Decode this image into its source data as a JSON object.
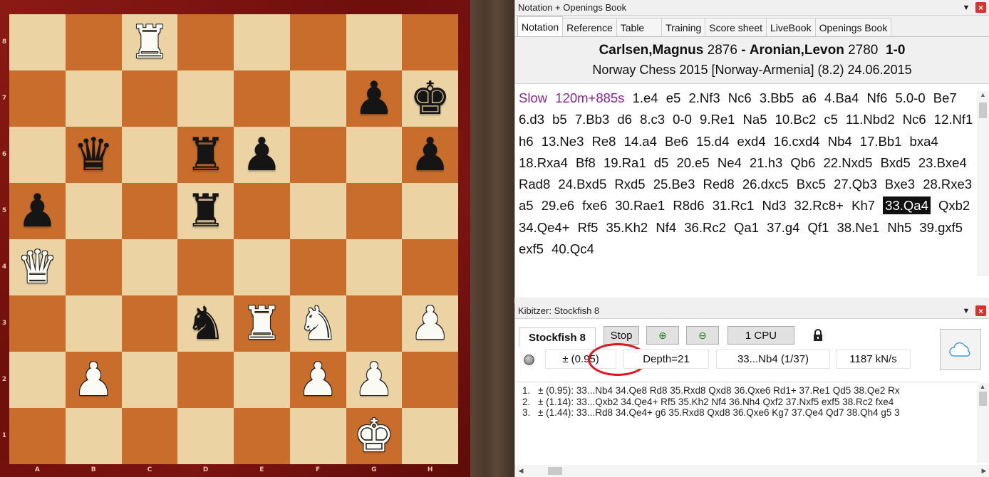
{
  "board": {
    "files": [
      "A",
      "B",
      "C",
      "D",
      "E",
      "F",
      "G",
      "H"
    ],
    "ranks": [
      "8",
      "7",
      "6",
      "5",
      "4",
      "3",
      "2",
      "1"
    ],
    "pieces": [
      {
        "square": "c8",
        "glyph": "♜",
        "color": "w",
        "name": "white-rook-icon"
      },
      {
        "square": "g7",
        "glyph": "♟",
        "color": "b",
        "name": "black-pawn-icon"
      },
      {
        "square": "h7",
        "glyph": "♚",
        "color": "b",
        "name": "black-king-icon"
      },
      {
        "square": "b6",
        "glyph": "♛",
        "color": "b",
        "name": "black-queen-icon"
      },
      {
        "square": "d6",
        "glyph": "♜",
        "color": "b",
        "name": "black-rook-icon"
      },
      {
        "square": "e6",
        "glyph": "♟",
        "color": "b",
        "name": "black-pawn-icon"
      },
      {
        "square": "h6",
        "glyph": "♟",
        "color": "b",
        "name": "black-pawn-icon"
      },
      {
        "square": "a5",
        "glyph": "♟",
        "color": "b",
        "name": "black-pawn-icon"
      },
      {
        "square": "d5",
        "glyph": "♜",
        "color": "b",
        "name": "black-rook-icon"
      },
      {
        "square": "a4",
        "glyph": "♛",
        "color": "w",
        "name": "white-queen-icon"
      },
      {
        "square": "d3",
        "glyph": "♞",
        "color": "b",
        "name": "black-knight-icon"
      },
      {
        "square": "e3",
        "glyph": "♜",
        "color": "w",
        "name": "white-rook-icon"
      },
      {
        "square": "f3",
        "glyph": "♞",
        "color": "w",
        "name": "white-knight-icon"
      },
      {
        "square": "h3",
        "glyph": "♟",
        "color": "w",
        "name": "white-pawn-icon"
      },
      {
        "square": "b2",
        "glyph": "♟",
        "color": "w",
        "name": "white-pawn-icon"
      },
      {
        "square": "f2",
        "glyph": "♟",
        "color": "w",
        "name": "white-pawn-icon"
      },
      {
        "square": "g2",
        "glyph": "♟",
        "color": "w",
        "name": "white-pawn-icon"
      },
      {
        "square": "g1",
        "glyph": "♚",
        "color": "w",
        "name": "white-king-icon"
      }
    ]
  },
  "notation": {
    "title": "Notation + Openings Book",
    "tabs": [
      "Notation",
      "Reference",
      "Table",
      "Training",
      "Score sheet",
      "LiveBook",
      "Openings Book"
    ],
    "white_player": "Carlsen,Magnus",
    "white_elo": "2876",
    "separator": "-",
    "black_player": "Aronian,Levon",
    "black_elo": "2780",
    "result": "1-0",
    "event": "Norway Chess 2015 [Norway-Armenia]  (8.2) 24.06.2015",
    "time_control": "Slow 120m+885s",
    "moves_before": "1.e4 e5 2.Nf3 Nc6 3.Bb5 a6 4.Ba4 Nf6 5.0-0 Be7 6.d3 b5 7.Bb3 d6 8.c3 0-0 9.Re1 Na5 10.Bc2 c5 11.Nbd2 Nc6 12.Nf1 h6 13.Ne3 Re8 14.a4 Be6 15.d4 exd4 16.cxd4 Nb4 17.Bb1 bxa4 18.Rxa4 Bf8 19.Ra1 d5 20.e5 Ne4 21.h3 Qb6 22.Nxd5 Bxd5 23.Bxe4 Rad8 24.Bxd5 Rxd5 25.Be3 Red8 26.dxc5 Bxc5 27.Qb3 Bxe3 28.Rxe3 a5 29.e6 fxe6 30.Rae1 R8d6 31.Rc1 Nd3 32.Rc8+ Kh7",
    "current_move": "33.Qa4",
    "moves_after": "Qxb2 34.Qe4+ Rf5 35.Kh2 Nf4 36.Rc2 Qa1 37.g4 Qf1 38.Ne1 Nh5 39.gxf5 exf5 40.Qc4"
  },
  "kibitzer": {
    "title": "Kibitzer: Stockfish 8",
    "engine_name": "Stockfish 8",
    "stop_label": "Stop",
    "cpu_label": "1 CPU",
    "evaluation": "±  (0.95)",
    "depth": "Depth=21",
    "current_line": "33...Nb4 (1/37)",
    "speed": "1187 kN/s",
    "lines": [
      {
        "n": "1.",
        "text": "±  (0.95): 33...Nb4 34.Qe8 Rd8 35.Rxd8 Qxd8 36.Qxe6 Rd1+ 37.Re1 Qd5 38.Qe2 Rx"
      },
      {
        "n": "2.",
        "text": "±  (1.14): 33...Qxb2 34.Qe4+ Rf5 35.Kh2 Nf4 36.Nh4 Qxf2 37.Nxf5 exf5 38.Rc2 fxe4"
      },
      {
        "n": "3.",
        "text": "±  (1.44): 33...Rd8 34.Qe4+ g6 35.Rxd8 Qxd8 36.Qxe6 Kg7 37.Qe4 Qd7 38.Qh4 g5 3"
      }
    ]
  },
  "colors": {
    "light_square": "#ecd3a4",
    "dark_square": "#c86d2b",
    "frame": "#7c1410",
    "time_control": "#8a2390",
    "annotation_oval": "#e0141b"
  }
}
